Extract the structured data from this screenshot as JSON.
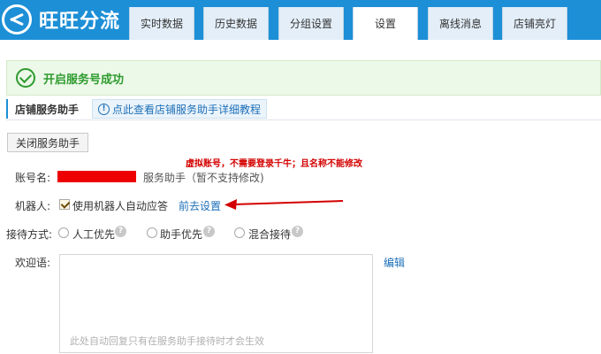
{
  "app": {
    "title": "旺旺分流"
  },
  "tabs": [
    {
      "label": "实时数据"
    },
    {
      "label": "历史数据"
    },
    {
      "label": "分组设置"
    },
    {
      "label": "设置",
      "active": true
    },
    {
      "label": "离线消息"
    },
    {
      "label": "店铺亮灯"
    }
  ],
  "success": {
    "message": "开启服务号成功",
    "icon": "check-circle-icon"
  },
  "section": {
    "title": "店铺服务助手",
    "help_link": "点此查看店铺服务助手详细教程",
    "icon": "info-icon"
  },
  "buttons": {
    "close_assistant": "关闭服务助手"
  },
  "annotation": {
    "text": "虚拟账号，不需要登录千牛；且名称不能修改",
    "color": "#d40000"
  },
  "form": {
    "account": {
      "label": "账号名:",
      "suffix": "服务助手（暂不支持修改)"
    },
    "robot": {
      "label": "机器人:",
      "checkbox_label": "使用机器人自动应答",
      "checked": true,
      "link": "前去设置"
    },
    "reception": {
      "label": "接待方式:",
      "options": [
        {
          "label": "人工优先",
          "selected": false
        },
        {
          "label": "助手优先",
          "selected": false
        },
        {
          "label": "混合接待",
          "selected": false
        }
      ]
    },
    "welcome": {
      "label": "欢迎语:",
      "edit_link": "编辑",
      "hint": "此处自动回复只有在服务助手接待时才会生效"
    }
  },
  "colors": {
    "brand": "#1d8fd6",
    "success": "#2e9b2e",
    "link": "#1d6fb8",
    "annotation": "#d40000"
  }
}
